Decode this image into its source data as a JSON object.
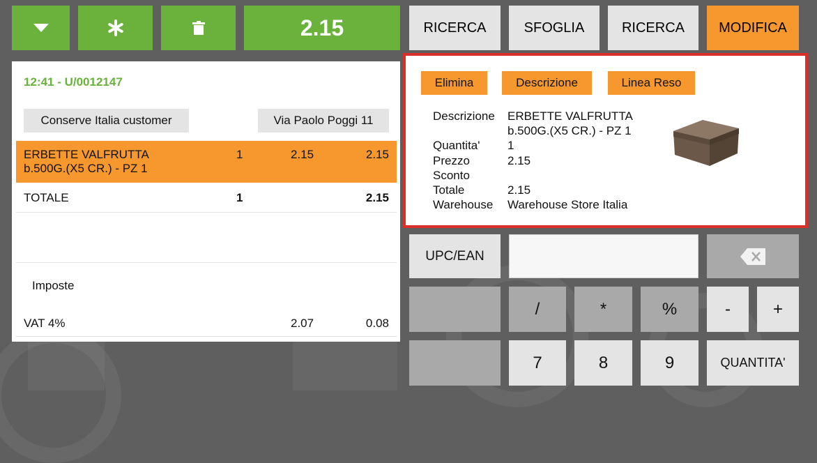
{
  "top_bar": {
    "total": "2.15"
  },
  "tabs": [
    {
      "label": "RICERCA"
    },
    {
      "label": "SFOGLIA"
    },
    {
      "label": "RICERCA"
    },
    {
      "label": "MODIFICA"
    }
  ],
  "receipt": {
    "time_ticket": "12:41 - U/0012147",
    "customer": "Conserve Italia customer",
    "address": "Via Paolo Poggi 11",
    "line": {
      "description_line1": "ERBETTE VALFRUTTA",
      "description_line2": "b.500G.(X5 CR.) - PZ 1",
      "qty": "1",
      "price": "2.15",
      "amount": "2.15"
    },
    "total": {
      "label": "TOTALE",
      "qty": "1",
      "amount": "2.15"
    },
    "taxes": {
      "label": "Imposte",
      "vat_label": "VAT 4%",
      "base": "2.07",
      "tax": "0.08"
    }
  },
  "detail": {
    "buttons": [
      "Elimina",
      "Descrizione",
      "Linea Reso"
    ],
    "labels": [
      "Descrizione",
      "",
      "Quantita'",
      "Prezzo",
      "Sconto",
      "Totale",
      "Warehouse"
    ],
    "values": [
      "ERBETTE VALFRUTTA",
      "b.500G.(X5 CR.) - PZ 1",
      "1",
      "2.15",
      "",
      "2.15",
      "Warehouse Store Italia"
    ]
  },
  "keypad": {
    "upc_label": "UPC/EAN",
    "input_value": "",
    "keys_row1": [
      "/",
      "*",
      "%",
      "-",
      "+"
    ],
    "keys_row2": [
      "7",
      "8",
      "9"
    ],
    "quantity_label": "QUANTITA'"
  },
  "colors": {
    "green": "#6ab23c",
    "orange": "#f7982f",
    "highlight_border": "#d9302c"
  }
}
